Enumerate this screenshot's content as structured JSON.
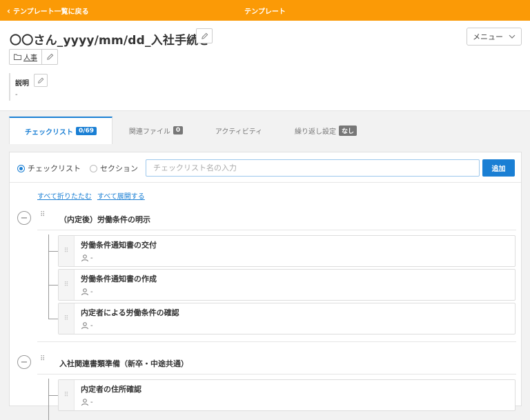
{
  "topbar": {
    "back_label": "テンプレート一覧に戻る",
    "title": "テンプレート"
  },
  "header": {
    "title": "〇〇さん_yyyy/mm/dd_入社手続き",
    "menu_label": "メニュー",
    "tag": "人事",
    "desc_label": "説明",
    "desc_value": "-"
  },
  "tabs": [
    {
      "label": "チェックリスト",
      "badge": "0/69"
    },
    {
      "label": "関連ファイル",
      "badge": "0"
    },
    {
      "label": "アクティビティ",
      "badge": ""
    },
    {
      "label": "繰り返し設定",
      "badge": "なし"
    }
  ],
  "add_row": {
    "radio_checklist": "チェックリスト",
    "radio_section": "セクション",
    "placeholder": "チェックリスト名の入力",
    "add_label": "追加"
  },
  "links": {
    "collapse_all": "すべて折りたたむ",
    "expand_all": "すべて展開する"
  },
  "sections": [
    {
      "title": "（内定後）労働条件の明示",
      "items": [
        {
          "name": "労働条件通知書の交付",
          "assignee": "-"
        },
        {
          "name": "労働条件通知書の作成",
          "assignee": "-"
        },
        {
          "name": "内定者による労働条件の確認",
          "assignee": "-"
        }
      ]
    },
    {
      "title": "入社関連書類準備（新卒・中途共通）",
      "items": [
        {
          "name": "内定者の住所確認",
          "assignee": "-"
        }
      ]
    }
  ],
  "colors": {
    "topbar": "#fb9a06",
    "accent": "#1a7fd4"
  },
  "icons": {
    "back": "chevron-left-icon",
    "edit": "pencil-icon",
    "folder": "folder-icon",
    "menu": "chevron-down-icon",
    "drag": "drag-grip-icon",
    "collapse": "minus-circle-icon",
    "user": "user-icon"
  }
}
